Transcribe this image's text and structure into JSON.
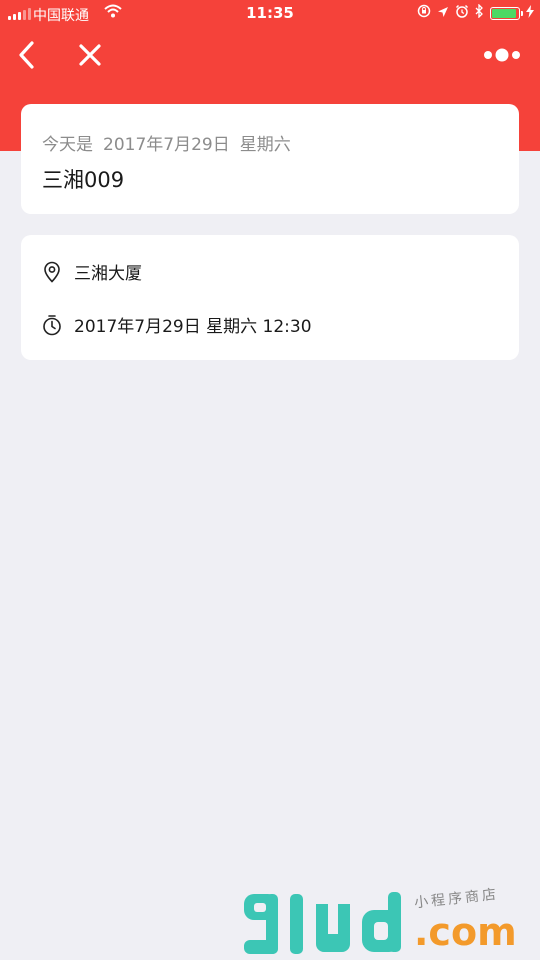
{
  "status_bar": {
    "carrier": "中国联通",
    "time": "11:35"
  },
  "colors": {
    "header": "#f5423a",
    "background": "#efeff4",
    "battery_fill": "#4cd964"
  },
  "nav": {
    "back_icon": "chevron-left-icon",
    "close_icon": "close-icon",
    "more_icon": "more-dots-icon"
  },
  "today_card": {
    "prefix": "今天是",
    "date": "2017年7月29日",
    "weekday": "星期六",
    "event_name": "三湘009"
  },
  "detail_card": {
    "location": "三湘大厦",
    "datetime": "2017年7月29日 星期六 12:30"
  },
  "watermark": {
    "logo_text": "glud",
    "domain_text": ".com",
    "tagline": "小程序商店"
  }
}
